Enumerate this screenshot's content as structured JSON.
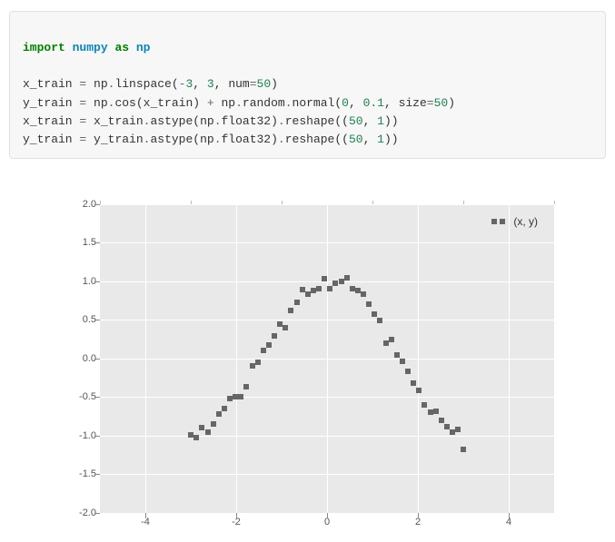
{
  "code": {
    "line1": {
      "kw": "import",
      "mod1": "numpy",
      "as": "as",
      "mod2": "np"
    },
    "line2a": "x_train ",
    "line2b": " np",
    "line2c": "linspace(",
    "line2_n1": "-3",
    "line2_n2": "3",
    "line2_num": "num",
    "line2_n3": "50",
    "line3a": "y_train ",
    "line3b": " np",
    "line3c": "cos(x_train) ",
    "line3d": " np",
    "line3e": "random",
    "line3f": "normal(",
    "line3_n1": "0",
    "line3_n2": "0.1",
    "line3_size": "size",
    "line3_n3": "50",
    "line4a": "x_train ",
    "line4b": " x_train",
    "line4c": "astype(np",
    "line4d": "float32)",
    "line4e": "reshape((",
    "line4_n1": "50",
    "line4_n2": "1",
    "line5a": "y_train ",
    "line5b": " y_train",
    "line5c": "astype(np",
    "line5d": "float32)",
    "line5e": "reshape((",
    "line5_n1": "50",
    "line5_n2": "1"
  },
  "chart_data": {
    "type": "scatter",
    "title": "",
    "xlabel": "",
    "ylabel": "",
    "xlim": [
      -5,
      5
    ],
    "ylim": [
      -2,
      2
    ],
    "xticks": [
      -4,
      -2,
      0,
      2,
      4
    ],
    "yticks": [
      -2.0,
      -1.5,
      -1.0,
      -0.5,
      0.0,
      0.5,
      1.0,
      1.5,
      2.0
    ],
    "legend": "(x, y)",
    "series": [
      {
        "name": "(x, y)",
        "x": [
          -3.0,
          -2.88,
          -2.76,
          -2.63,
          -2.51,
          -2.39,
          -2.27,
          -2.14,
          -2.02,
          -1.9,
          -1.78,
          -1.65,
          -1.53,
          -1.41,
          -1.29,
          -1.16,
          -1.04,
          -0.92,
          -0.8,
          -0.67,
          -0.55,
          -0.43,
          -0.31,
          -0.18,
          -0.06,
          0.06,
          0.18,
          0.31,
          0.43,
          0.55,
          0.67,
          0.8,
          0.92,
          1.04,
          1.16,
          1.29,
          1.41,
          1.53,
          1.65,
          1.78,
          1.9,
          2.02,
          2.14,
          2.27,
          2.39,
          2.51,
          2.63,
          2.76,
          2.88,
          3.0
        ],
        "y": [
          -0.99,
          -1.02,
          -0.9,
          -0.95,
          -0.85,
          -0.72,
          -0.65,
          -0.52,
          -0.5,
          -0.5,
          -0.36,
          -0.1,
          -0.05,
          0.1,
          0.18,
          0.29,
          0.45,
          0.4,
          0.62,
          0.73,
          0.89,
          0.83,
          0.88,
          0.9,
          1.03,
          0.9,
          0.98,
          1.0,
          1.05,
          0.9,
          0.88,
          0.84,
          0.7,
          0.58,
          0.49,
          0.2,
          0.25,
          0.05,
          -0.04,
          -0.16,
          -0.32,
          -0.41,
          -0.6,
          -0.7,
          -0.68,
          -0.8,
          -0.88,
          -0.95,
          -0.92,
          -1.18
        ]
      }
    ]
  }
}
